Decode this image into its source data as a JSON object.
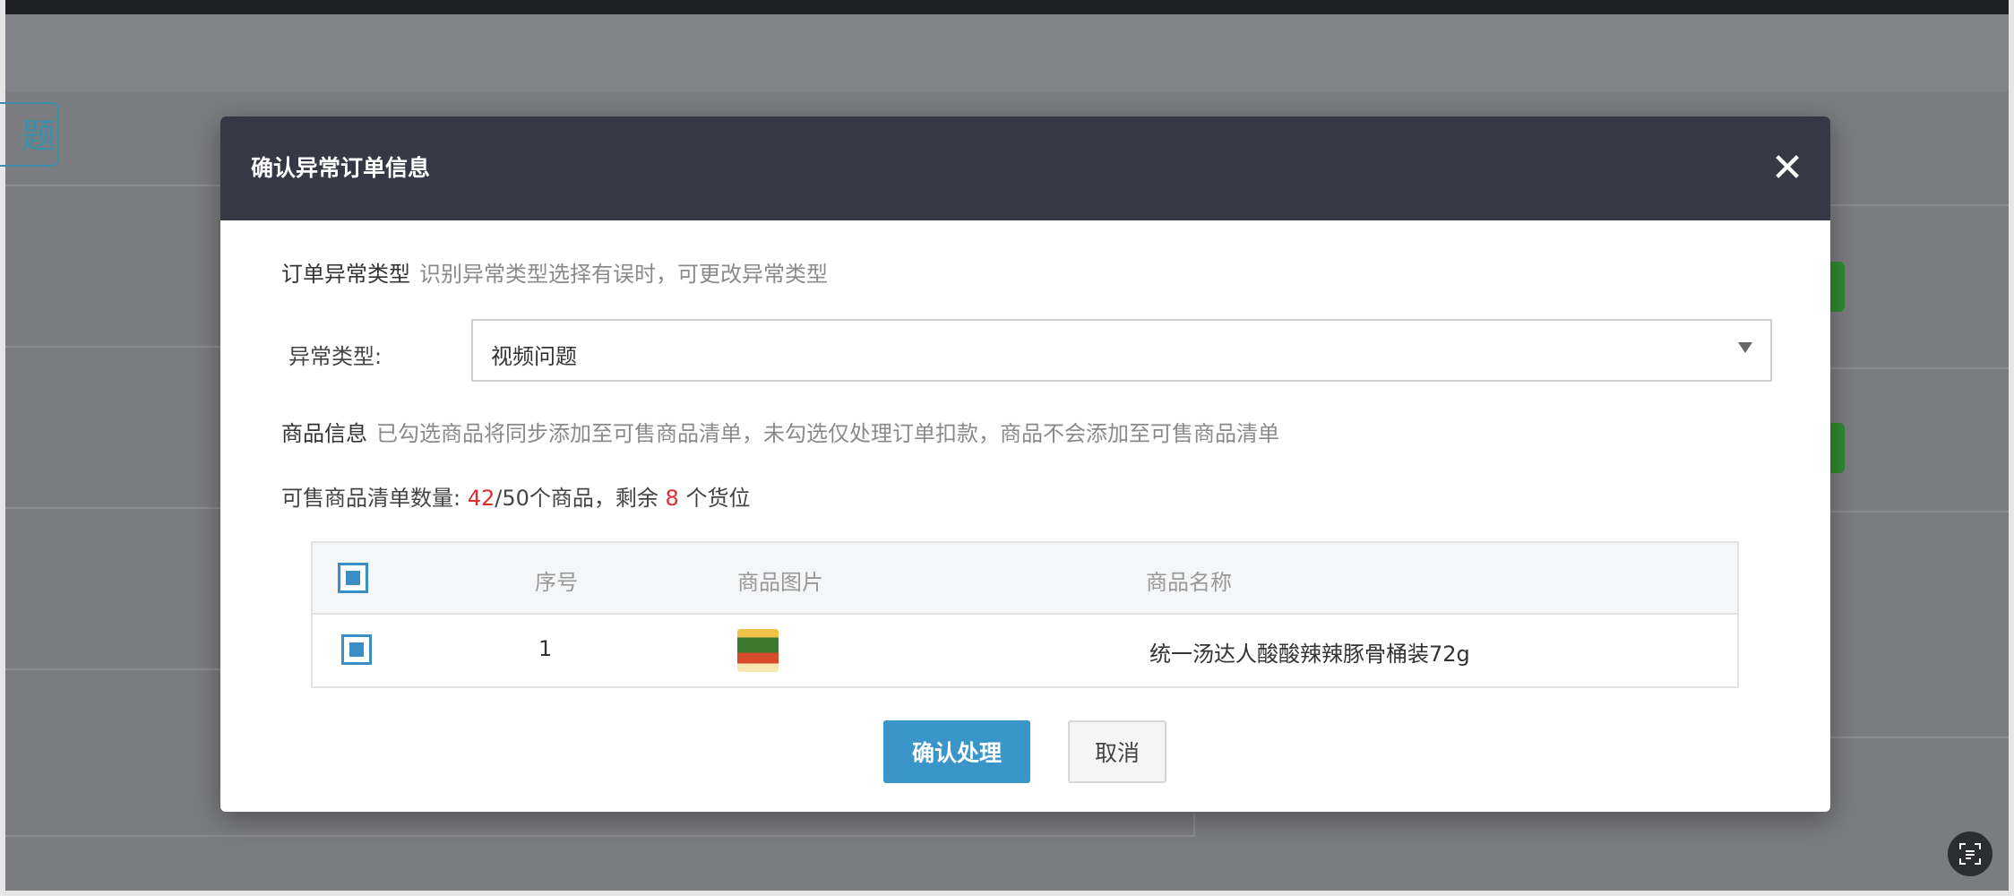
{
  "background": {
    "tag_text": "题"
  },
  "modal": {
    "title": "确认异常订单信息",
    "close_icon": "close-icon",
    "order_type_section": {
      "label": "订单异常类型",
      "hint": "识别异常类型选择有误时，可更改异常类型"
    },
    "type_field": {
      "label": "异常类型:",
      "value": "视频问题"
    },
    "product_section": {
      "label": "商品信息",
      "hint": "已勾选商品将同步添加至可售商品清单，未勾选仅处理订单扣款，商品不会添加至可售商品清单"
    },
    "count_line": {
      "prefix": "可售商品清单数量:",
      "current": "42",
      "total": "/50个商品，剩余",
      "remaining": "8",
      "suffix": "个货位"
    },
    "table": {
      "headers": [
        "序号",
        "商品图片",
        "商品名称"
      ],
      "rows": [
        {
          "index": "1",
          "name": "统一汤达人酸酸辣辣豚骨桶装72g"
        }
      ]
    },
    "buttons": {
      "confirm": "确认处理",
      "cancel": "取消"
    }
  },
  "colors": {
    "header_bg": "#363846",
    "primary": "#3a95c9",
    "accent_red": "#e02d2d"
  }
}
